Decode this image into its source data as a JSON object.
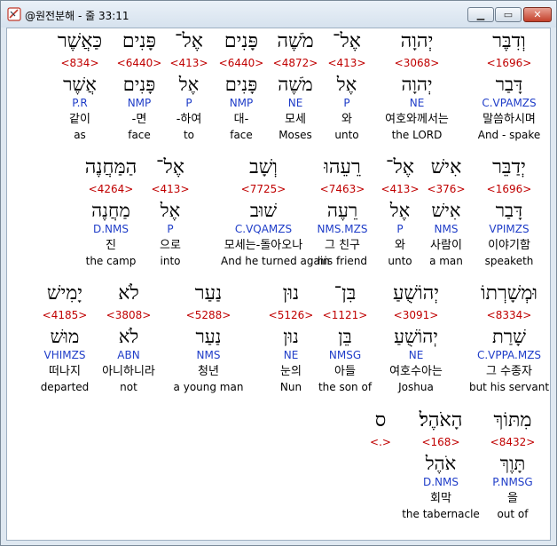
{
  "window": {
    "title": "@원전분해 - 줄 33:11"
  },
  "rows": [
    [
      {
        "heb": "וְדִבֶּר",
        "strong": "<1696>",
        "lemma": "דָּבַר",
        "parse": "C.VPAMZS",
        "kor": "말씀하시며",
        "eng": "And - spake"
      },
      {
        "heb": "יְהוָה",
        "strong": "<3068>",
        "lemma": "יְהוָה",
        "parse": "NE",
        "kor": "여호와께서는",
        "eng": "the LORD"
      },
      {
        "heb": "אֶל־",
        "strong": "<413>",
        "lemma": "אֶל",
        "parse": "P",
        "kor": "와",
        "eng": "unto"
      },
      {
        "heb": "מֹשֶׁה",
        "strong": "<4872>",
        "lemma": "מֹשֶׁה",
        "parse": "NE",
        "kor": "모세",
        "eng": "Moses"
      },
      {
        "heb": "פָּנִים",
        "strong": "<6440>",
        "lemma": "פָּנִים",
        "parse": "NMP",
        "kor": "대-",
        "eng": "face"
      },
      {
        "heb": "אֶל־",
        "strong": "<413>",
        "lemma": "אֶל",
        "parse": "P",
        "kor": "-하여",
        "eng": "to"
      },
      {
        "heb": "פָּנִים",
        "strong": "<6440>",
        "lemma": "פָּנִים",
        "parse": "NMP",
        "kor": "-면",
        "eng": "face"
      },
      {
        "heb": "כַּאֲשֶׁר",
        "strong": "<834>",
        "lemma": "אֲשֶׁר",
        "parse": "P.R",
        "kor": "같이",
        "eng": "as"
      }
    ],
    [
      {
        "heb": "יְדַבֵּר",
        "strong": "<1696>",
        "lemma": "דָּבַר",
        "parse": "VPIMZS",
        "kor": "이야기함",
        "eng": "speaketh"
      },
      {
        "heb": "אִישׁ",
        "strong": "<376>",
        "lemma": "אִישׁ",
        "parse": "NMS",
        "kor": "사람이",
        "eng": "a man"
      },
      {
        "heb": "אֶל־",
        "strong": "<413>",
        "lemma": "אֶל",
        "parse": "P",
        "kor": "와",
        "eng": "unto"
      },
      {
        "heb": "רֵעֵהוּ",
        "strong": "<7463>",
        "lemma": "רֵעֶה",
        "parse": "NMS.MZS",
        "kor": "그 친구",
        "eng": "his friend"
      },
      {
        "heb": "וְשָׁב",
        "strong": "<7725>",
        "lemma": "שׁוּב",
        "parse": "C.VQAMZS",
        "kor": "모세는-돌아오나",
        "eng": "And he turned again"
      },
      {
        "heb": "אֶל־",
        "strong": "<413>",
        "lemma": "אֶל",
        "parse": "P",
        "kor": "으로",
        "eng": "into"
      },
      {
        "heb": "הַמַּחֲנֶה",
        "strong": "<4264>",
        "lemma": "מַחֲנֶה",
        "parse": "D.NMS",
        "kor": "진",
        "eng": "the camp"
      }
    ],
    [
      {
        "heb": "וּמְשָׁרְתוֹ",
        "strong": "<8334>",
        "lemma": "שָׁרַת",
        "parse": "C.VPPA.MZS",
        "kor": "그 수종자",
        "eng": "but his servant"
      },
      {
        "heb": "יְהוֹשֻׁעַ",
        "strong": "<3091>",
        "lemma": "יְהוֹשֻׁעַ",
        "parse": "NE",
        "kor": "여호수아는",
        "eng": "Joshua"
      },
      {
        "heb": "בִּן־",
        "strong": "<1121>",
        "lemma": "בֵּן",
        "parse": "NMSG",
        "kor": "아들",
        "eng": "the son of"
      },
      {
        "heb": "נוּן",
        "strong": "<5126>",
        "lemma": "נוּן",
        "parse": "NE",
        "kor": "눈의",
        "eng": "Nun"
      },
      {
        "heb": "נַעַר",
        "strong": "<5288>",
        "lemma": "נַעַר",
        "parse": "NMS",
        "kor": "청년",
        "eng": "a young man"
      },
      {
        "heb": "לֹא",
        "strong": "<3808>",
        "lemma": "לֹא",
        "parse": "ABN",
        "kor": "아니하니라",
        "eng": "not"
      },
      {
        "heb": "יָמִישׁ",
        "strong": "<4185>",
        "lemma": "מוּשׁ",
        "parse": "VHIMZS",
        "kor": "떠나지",
        "eng": "departed"
      }
    ],
    [
      {
        "heb": "מִתּוֹךְ",
        "strong": "<8432>",
        "lemma": "תָּוֶךְ",
        "parse": "P.NMSG",
        "kor": "을",
        "eng": "out of"
      },
      {
        "heb": "הָאֹהֶל׃",
        "strong": "<168>",
        "lemma": "אֹהֶל",
        "parse": "D.NMS",
        "kor": "회막",
        "eng": "the tabernacle"
      },
      {
        "heb": "ס",
        "strong": "<.>",
        "lemma": "",
        "parse": "",
        "kor": "",
        "eng": ""
      }
    ]
  ]
}
